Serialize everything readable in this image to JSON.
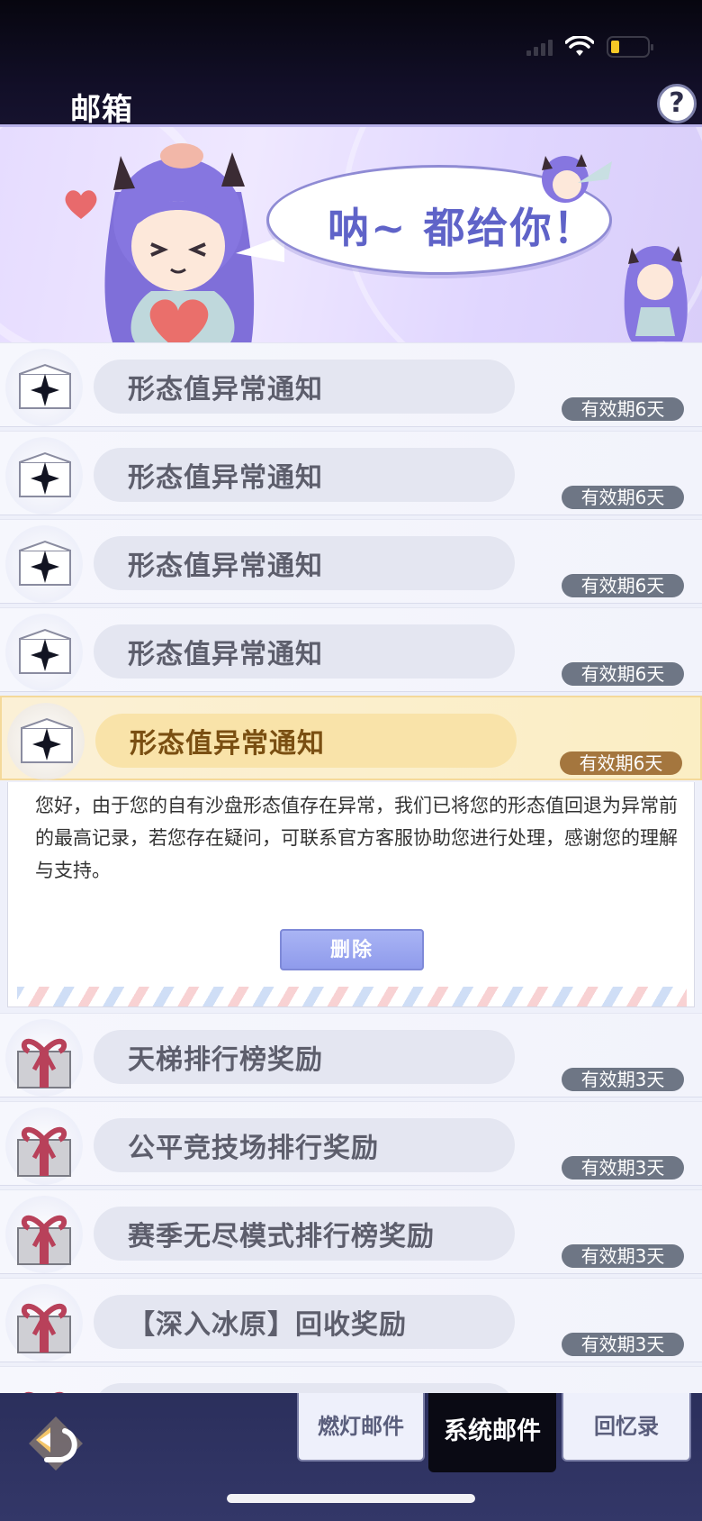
{
  "header": {
    "title": "邮箱",
    "help_label": "?"
  },
  "banner": {
    "speech": "呐~ 都给你！"
  },
  "mails": [
    {
      "name": "形态值异常通知",
      "expiry": "有效期6天",
      "icon": "envelope-icon",
      "active": false
    },
    {
      "name": "形态值异常通知",
      "expiry": "有效期6天",
      "icon": "envelope-icon",
      "active": false
    },
    {
      "name": "形态值异常通知",
      "expiry": "有效期6天",
      "icon": "envelope-icon",
      "active": false
    },
    {
      "name": "形态值异常通知",
      "expiry": "有效期6天",
      "icon": "envelope-icon",
      "active": false
    },
    {
      "name": "形态值异常通知",
      "expiry": "有效期6天",
      "icon": "envelope-icon",
      "active": true
    }
  ],
  "detail": {
    "body": "您好，由于您的自有沙盘形态值存在异常，我们已将您的形态值回退为异常前的最高记录，若您存在疑问，可联系官方客服协助您进行处理，感谢您的理解与支持。",
    "delete_label": "删除"
  },
  "gift_mails": [
    {
      "name": "天梯排行榜奖励",
      "expiry": "有效期3天",
      "icon": "gift-box-icon"
    },
    {
      "name": "公平竞技场排行奖励",
      "expiry": "有效期3天",
      "icon": "gift-box-icon"
    },
    {
      "name": "赛季无尽模式排行榜奖励",
      "expiry": "有效期3天",
      "icon": "gift-box-icon"
    },
    {
      "name": "【深入冰原】回收奖励",
      "expiry": "有效期3天",
      "icon": "gift-box-icon"
    }
  ],
  "tabs": [
    {
      "label": "燃灯邮件",
      "active": false
    },
    {
      "label": "系统邮件",
      "active": true
    },
    {
      "label": "回忆录",
      "active": false
    }
  ],
  "colors": {
    "accent": "#5f63c8",
    "expiry_badge": "#6e7685",
    "active_row": "#fbeec4"
  }
}
